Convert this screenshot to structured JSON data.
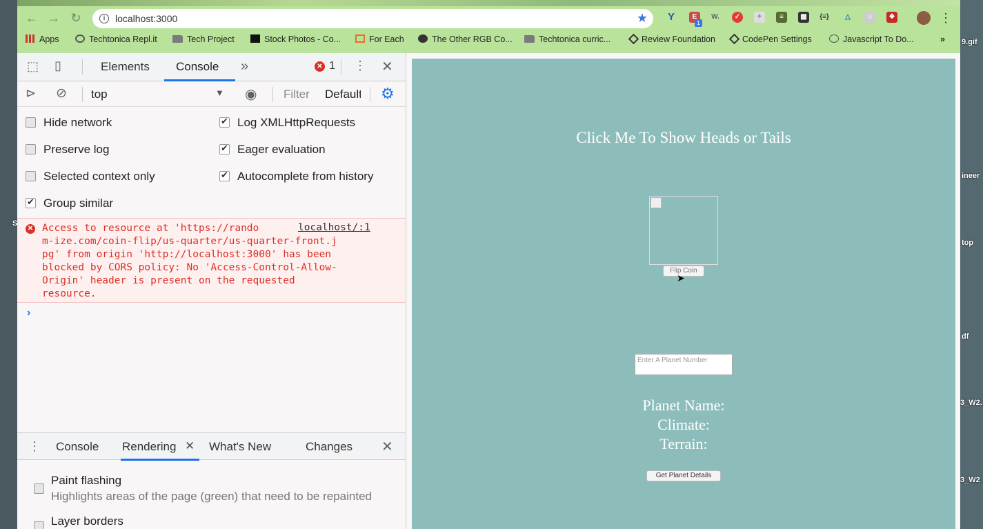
{
  "browser": {
    "url": "localhost:3000",
    "bookmarks": [
      "Apps",
      "Techtonica Repl.it",
      "Tech Project",
      "Stock Photos - Co...",
      "For Each",
      "The Other RGB Co...",
      "Techtonica curric...",
      "Review Foundation",
      "CodePen Settings",
      "Javascript To Do..."
    ],
    "extension_badge": "1"
  },
  "desktop": {
    "labels": [
      "9.gif",
      "ineer",
      "top",
      "df",
      "3_W2.",
      "3_W2",
      "S"
    ]
  },
  "devtools": {
    "tabs": [
      "Elements",
      "Console"
    ],
    "active_tab": "Console",
    "error_count": "1",
    "context": "top",
    "filter_placeholder": "Filter",
    "levels": "Default",
    "settings": {
      "hide_network": {
        "label": "Hide network",
        "checked": false
      },
      "preserve_log": {
        "label": "Preserve log",
        "checked": false
      },
      "selected_context": {
        "label": "Selected context only",
        "checked": false
      },
      "group_similar": {
        "label": "Group similar",
        "checked": true
      },
      "log_xhr": {
        "label": "Log XMLHttpRequests",
        "checked": true
      },
      "eager_eval": {
        "label": "Eager evaluation",
        "checked": true
      },
      "autocomplete": {
        "label": "Autocomplete from history",
        "checked": true
      }
    },
    "error": {
      "source": "localhost/:1",
      "lines": [
        "Access to resource at 'https://rando",
        "m-ize.com/coin-flip/us-quarter/us-quarter-front.j",
        "pg' from origin 'http://localhost:3000' has been",
        "blocked by CORS policy: No 'Access-Control-Allow-",
        "Origin' header is present on the requested",
        "resource."
      ]
    },
    "drawer": {
      "tabs": [
        "Console",
        "Rendering",
        "What's New",
        "Changes"
      ],
      "active": "Rendering",
      "paint_flashing": {
        "label": "Paint flashing",
        "desc": "Highlights areas of the page (green) that need to be repainted"
      },
      "layer_borders": {
        "label": "Layer borders"
      }
    }
  },
  "page": {
    "title": "Click Me To Show Heads or Tails",
    "flip_button": "Flip Coin",
    "planet_placeholder": "Enter A Planet Number",
    "planet_name": "Planet Name:",
    "climate": "Climate:",
    "terrain": "Terrain:",
    "details_button": "Get Planet Details",
    "bg_color": "#8dbdbb"
  }
}
